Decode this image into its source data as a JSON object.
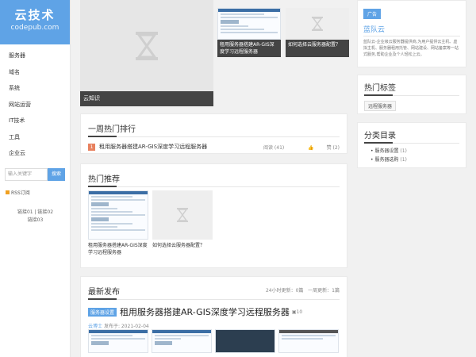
{
  "logo": {
    "title": "云技术",
    "subtitle": "codepub.com"
  },
  "nav": [
    "服务器",
    "域名",
    "系统",
    "网站运营",
    "IT技术",
    "工具",
    "企业云"
  ],
  "search": {
    "placeholder": "输入关键字",
    "button": "搜索"
  },
  "rss": "RSS订阅",
  "links": {
    "line1": "链接01 | 链接02",
    "line2": "链接03"
  },
  "banner": {
    "caption": "云知识"
  },
  "thumbs": [
    {
      "caption": "租用服务器搭建AR-GIS深度学习远程服务器"
    },
    {
      "caption": "如何选择云服务器配置？"
    }
  ],
  "weekly": {
    "title": "一周热门排行",
    "items": [
      {
        "rank": "1",
        "title": "租用服务器搭建AR-GIS深度学习远程服务器",
        "reads": "阅读 (41)",
        "likes": "赞 (2)"
      }
    ]
  },
  "recommend": {
    "title": "热门推荐",
    "items": [
      {
        "title": "租用服务器搭建AR-GIS深度学习远程服务器"
      },
      {
        "title": "如何选择云服务器配置？"
      }
    ]
  },
  "latest": {
    "title": "最新发布",
    "updates_24h": "24小时更新：0篇",
    "updates_week": "一周更新：1篇",
    "article": {
      "category": "服务器设置",
      "title": "租用服务器搭建AR-GIS深度学习远程服务器",
      "image_count": "10",
      "author": "云博士",
      "date": "发布于: 2021-02-04"
    }
  },
  "ad": {
    "badge": "广告",
    "title": "蓝队云",
    "desc": "蓝队云-企业级云服务器提供商,为用户提供云主机、虚拟主机、服务器租用托管、网站建设、网站备案等一站式服务,帮助企业及个人轻松上云。"
  },
  "hot_tags": {
    "title": "热门标签",
    "tags": [
      "远程服务器"
    ]
  },
  "categories": {
    "title": "分类目录",
    "items": [
      {
        "name": "服务器设置",
        "count": "(1)"
      },
      {
        "name": "服务器选购",
        "count": "(1)"
      }
    ]
  },
  "colors": {
    "accent": "#5fa3e6",
    "rank": "#e8815f",
    "banner_caption": "#444444"
  }
}
